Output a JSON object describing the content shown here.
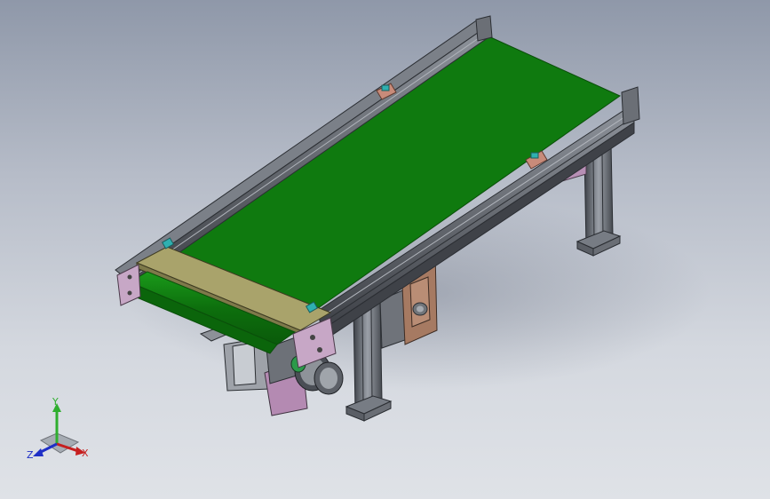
{
  "viewport": {
    "background_top": "#8f98a9",
    "background_bottom": "#dfe2e7"
  },
  "model": {
    "belt_color": "#0f7a0f",
    "frame_color": "#5b5f66",
    "plate_color": "#c7a7c6",
    "guard_color": "#a8a36a",
    "bracket_color": "#b07a62"
  },
  "triad": {
    "y_label": "Y",
    "x_label": "X",
    "z_label": "Z",
    "y_color": "#2fae2f",
    "x_color": "#c61f1f",
    "z_color": "#1f2fc6"
  }
}
